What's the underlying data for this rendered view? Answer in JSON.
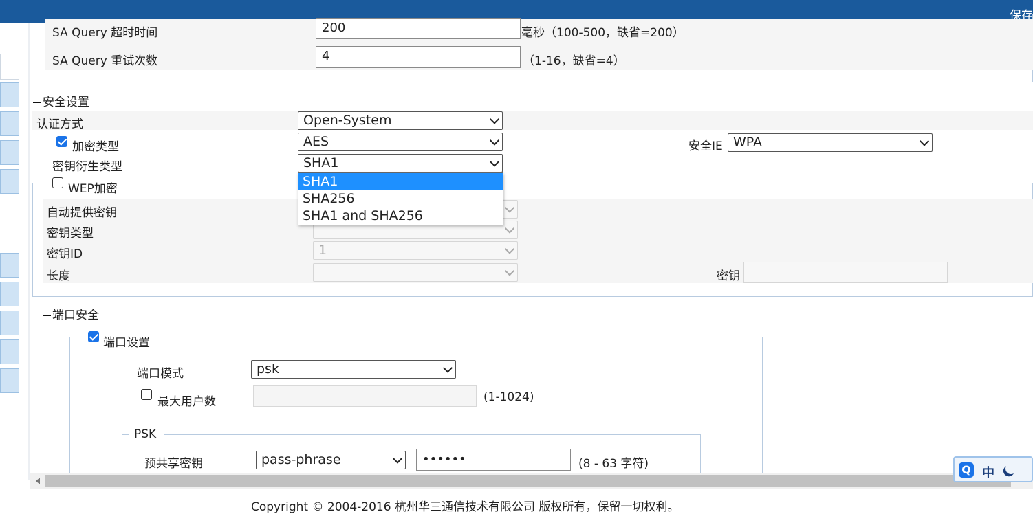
{
  "topbar": {
    "save_label": "保存"
  },
  "sa_query": {
    "timeout_label": "SA Query 超时时间",
    "timeout_value": "200",
    "timeout_hint": "毫秒（100-500，缺省=200）",
    "retry_label": "SA Query 重试次数",
    "retry_value": "4",
    "retry_hint": "（1-16，缺省=4）"
  },
  "security": {
    "section_title": "安全设置",
    "auth_label": "认证方式",
    "auth_value": "Open-System",
    "encryption_label": "加密类型",
    "encryption_checked": true,
    "encryption_value": "AES",
    "security_ie_label": "安全IE",
    "security_ie_value": "WPA",
    "key_derivation_label": "密钥衍生类型",
    "key_derivation_value": "SHA1",
    "key_derivation_options": [
      "SHA1",
      "SHA256",
      "SHA1 and SHA256"
    ],
    "key_derivation_highlighted": "SHA1"
  },
  "wep": {
    "title": "WEP加密",
    "checked": false,
    "auto_key_label": "自动提供密钥",
    "key_type_label": "密钥类型",
    "key_id_label": "密钥ID",
    "key_id_value": "1",
    "length_label": "长度",
    "key_label": "密钥"
  },
  "port_security": {
    "section_title": "端口安全",
    "port_settings_label": "端口设置",
    "port_settings_checked": true,
    "port_mode_label": "端口模式",
    "port_mode_value": "psk",
    "max_users_label": "最大用户数",
    "max_users_checked": false,
    "max_users_hint": "(1-1024)",
    "psk_title": "PSK",
    "preshared_key_label": "预共享密钥",
    "preshared_key_type": "pass-phrase",
    "preshared_key_value": "••••••",
    "preshared_key_hint": "(8 - 63 字符)"
  },
  "footer": {
    "copyright": "Copyright © 2004-2016 杭州华三通信技术有限公司 版权所有，保留一切权利。"
  },
  "ime": {
    "logo": "Q",
    "mode": "中"
  },
  "colors": {
    "topbar": "#1a5a9c",
    "highlight": "#1e90ff",
    "checkbox": "#1a73e8"
  }
}
